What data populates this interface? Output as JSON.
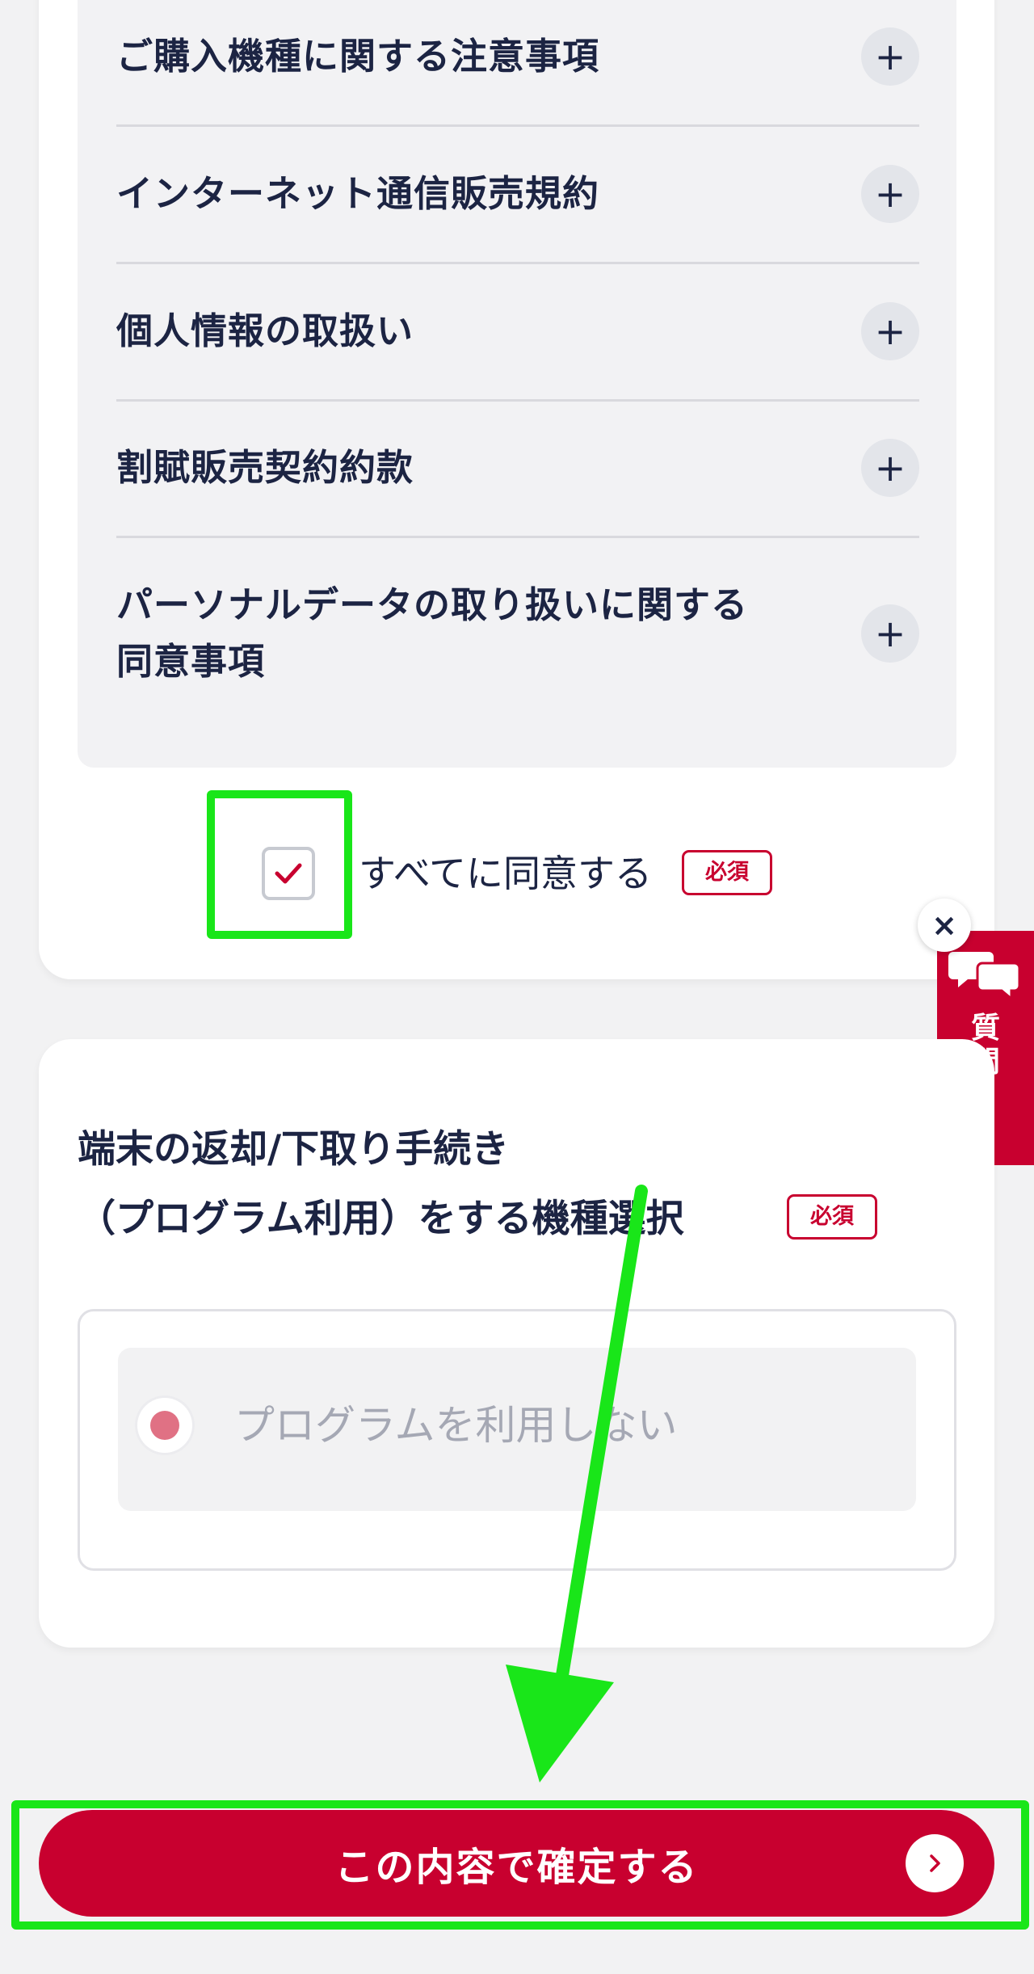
{
  "terms": {
    "items": [
      {
        "label": "ご購入機種に関する注意事項",
        "expand_icon": "plus-icon"
      },
      {
        "label": "インターネット通信販売規約",
        "expand_icon": "plus-icon"
      },
      {
        "label": "個人情報の取扱い",
        "expand_icon": "plus-icon"
      },
      {
        "label": "割賦販売契約約款",
        "expand_icon": "plus-icon"
      },
      {
        "label_line1": "パーソナルデータの取り扱いに関する",
        "label_line2": "同意事項",
        "expand_icon": "plus-icon"
      }
    ]
  },
  "agree": {
    "label": "すべてに同意する",
    "checked": true,
    "required_badge": "必須"
  },
  "chat": {
    "close_symbol": "×",
    "tab_text": "質問",
    "icon": "chat-bubbles-icon"
  },
  "device_selection": {
    "title_line1": "端末の返却/下取り手続き",
    "title_line2": "（プログラム利用）をする機種選択",
    "required_badge": "必須",
    "option_label": "プログラムを利用しない",
    "option_selected": true
  },
  "confirm": {
    "label": "この内容で確定する",
    "icon": "chevron-right-icon"
  },
  "colors": {
    "brand": "#c8002f",
    "text": "#1c2443",
    "highlight": "#19e619",
    "page_bg": "#f2f2f3"
  }
}
